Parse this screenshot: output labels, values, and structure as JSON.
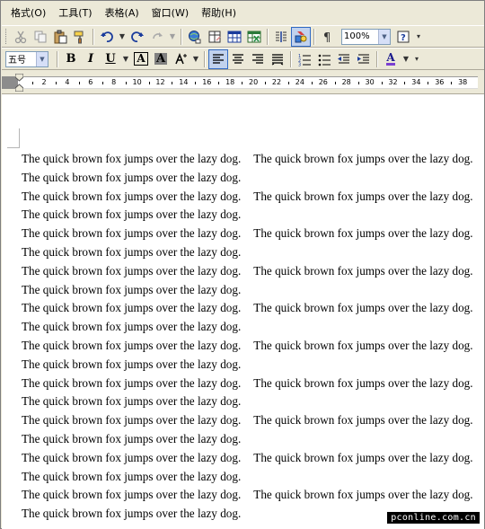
{
  "menubar": {
    "items": [
      "格式(O)",
      "工具(T)",
      "表格(A)",
      "窗口(W)",
      "帮助(H)"
    ]
  },
  "toolbar_standard": {
    "zoom_value": "100%",
    "icons": [
      "cut-icon",
      "copy-icon",
      "paste-icon",
      "format-painter-icon",
      "undo-icon",
      "redo-icon",
      "hyperlink-icon",
      "tables-borders-icon",
      "insert-table-icon",
      "insert-excel-icon",
      "columns-icon",
      "drawing-icon",
      "show-hide-icon",
      "help-icon"
    ]
  },
  "toolbar_formatting": {
    "font_size": "五号",
    "bold_label": "B",
    "italic_label": "I",
    "underline_label": "U",
    "char_border_label": "A",
    "char_shading_label": "A",
    "font_color_label": "A"
  },
  "ruler": {
    "numbers": [
      "2",
      "4",
      "6",
      "8",
      "10",
      "12",
      "14",
      "16",
      "18",
      "20",
      "22",
      "24",
      "26",
      "28",
      "30",
      "32",
      "34",
      "36",
      "38"
    ]
  },
  "document": {
    "sentence": "The quick brown fox jumps over the lazy dog.",
    "lines": [
      [
        "The quick brown fox jumps over the lazy dog.",
        "The quick brown fox jumps over the lazy dog."
      ],
      [
        "The quick brown fox jumps over the lazy dog."
      ],
      [
        "The quick brown fox jumps over the lazy dog.",
        "The quick brown fox jumps over the lazy dog."
      ],
      [
        "The quick brown fox jumps over the lazy dog."
      ],
      [
        "The quick brown fox jumps over the lazy dog.",
        "The quick brown fox jumps over the lazy dog."
      ],
      [
        "The quick brown fox jumps over the lazy dog."
      ],
      [
        "The quick brown fox jumps over the lazy dog.",
        "The quick brown fox jumps over the lazy dog."
      ],
      [
        "The quick brown fox jumps over the lazy dog."
      ],
      [
        "The quick brown fox jumps over the lazy dog.",
        "The quick brown fox jumps over the lazy dog."
      ],
      [
        "The quick brown fox jumps over the lazy dog."
      ],
      [
        "The quick brown fox jumps over the lazy dog.",
        "The quick brown fox jumps over the lazy dog."
      ],
      [
        "The quick brown fox jumps over the lazy dog."
      ],
      [
        "The quick brown fox jumps over the lazy dog.",
        "The quick brown fox jumps over the lazy dog."
      ],
      [
        "The quick brown fox jumps over the lazy dog."
      ],
      [
        "The quick brown fox jumps over the lazy dog.",
        "The quick brown fox jumps over the lazy dog."
      ],
      [
        "The quick brown fox jumps over the lazy dog."
      ],
      [
        "The quick brown fox jumps over the lazy dog.",
        "The quick brown fox jumps over the lazy dog."
      ],
      [
        "The quick brown fox jumps over the lazy dog."
      ],
      [
        "The quick brown fox jumps over the lazy dog.",
        "The quick brown fox jumps over the lazy dog."
      ],
      [
        "The quick brown fox jumps over the lazy dog."
      ]
    ]
  },
  "watermark": "pconline.com.cn",
  "colors": {
    "chrome": "#ece9d8",
    "pressed": "#c1d2ee",
    "font_color_bar": "#7b3fd1"
  }
}
